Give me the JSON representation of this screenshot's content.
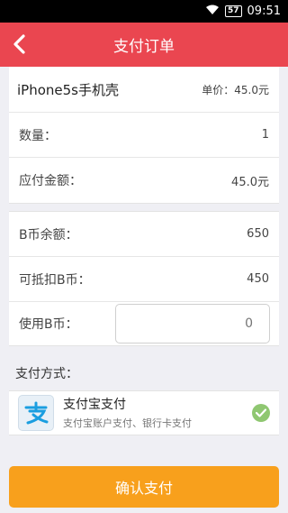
{
  "status_bar": {
    "battery": "57",
    "time": "09:51"
  },
  "header": {
    "title": "支付订单"
  },
  "product": {
    "name": "iPhone5s手机壳",
    "unit_price": "单价：45.0元"
  },
  "order": {
    "quantity_label": "数量：",
    "quantity_value": "1",
    "amount_label": "应付金额：",
    "amount_value": "45.0元"
  },
  "bcoin": {
    "balance_label": "B币余额：",
    "balance_value": "650",
    "deductible_label": "可抵扣B币：",
    "deductible_value": "450",
    "use_label": "使用B币：",
    "use_placeholder": "0"
  },
  "payment": {
    "section_title": "支付方式：",
    "method_name": "支付宝支付",
    "method_desc": "支付宝账户支付、银行卡支付"
  },
  "confirm_button": "确认支付",
  "colors": {
    "header": "#ea4650",
    "confirm": "#f8a01c",
    "check": "#8fc771"
  }
}
